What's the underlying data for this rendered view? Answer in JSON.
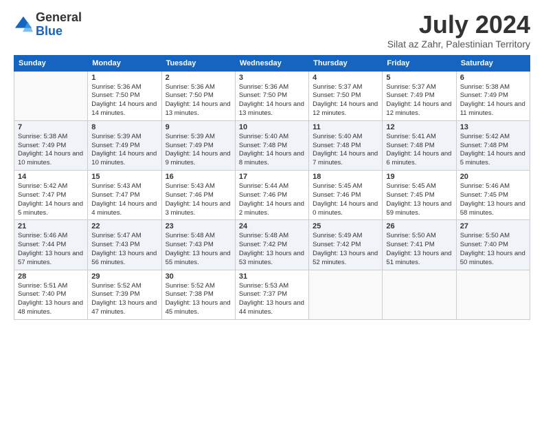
{
  "logo": {
    "general": "General",
    "blue": "Blue"
  },
  "title": "July 2024",
  "subtitle": "Silat az Zahr, Palestinian Territory",
  "days_of_week": [
    "Sunday",
    "Monday",
    "Tuesday",
    "Wednesday",
    "Thursday",
    "Friday",
    "Saturday"
  ],
  "weeks": [
    [
      {
        "day": "",
        "sunrise": "",
        "sunset": "",
        "daylight": ""
      },
      {
        "day": "1",
        "sunrise": "Sunrise: 5:36 AM",
        "sunset": "Sunset: 7:50 PM",
        "daylight": "Daylight: 14 hours and 14 minutes."
      },
      {
        "day": "2",
        "sunrise": "Sunrise: 5:36 AM",
        "sunset": "Sunset: 7:50 PM",
        "daylight": "Daylight: 14 hours and 13 minutes."
      },
      {
        "day": "3",
        "sunrise": "Sunrise: 5:36 AM",
        "sunset": "Sunset: 7:50 PM",
        "daylight": "Daylight: 14 hours and 13 minutes."
      },
      {
        "day": "4",
        "sunrise": "Sunrise: 5:37 AM",
        "sunset": "Sunset: 7:50 PM",
        "daylight": "Daylight: 14 hours and 12 minutes."
      },
      {
        "day": "5",
        "sunrise": "Sunrise: 5:37 AM",
        "sunset": "Sunset: 7:49 PM",
        "daylight": "Daylight: 14 hours and 12 minutes."
      },
      {
        "day": "6",
        "sunrise": "Sunrise: 5:38 AM",
        "sunset": "Sunset: 7:49 PM",
        "daylight": "Daylight: 14 hours and 11 minutes."
      }
    ],
    [
      {
        "day": "7",
        "sunrise": "Sunrise: 5:38 AM",
        "sunset": "Sunset: 7:49 PM",
        "daylight": "Daylight: 14 hours and 10 minutes."
      },
      {
        "day": "8",
        "sunrise": "Sunrise: 5:39 AM",
        "sunset": "Sunset: 7:49 PM",
        "daylight": "Daylight: 14 hours and 10 minutes."
      },
      {
        "day": "9",
        "sunrise": "Sunrise: 5:39 AM",
        "sunset": "Sunset: 7:49 PM",
        "daylight": "Daylight: 14 hours and 9 minutes."
      },
      {
        "day": "10",
        "sunrise": "Sunrise: 5:40 AM",
        "sunset": "Sunset: 7:48 PM",
        "daylight": "Daylight: 14 hours and 8 minutes."
      },
      {
        "day": "11",
        "sunrise": "Sunrise: 5:40 AM",
        "sunset": "Sunset: 7:48 PM",
        "daylight": "Daylight: 14 hours and 7 minutes."
      },
      {
        "day": "12",
        "sunrise": "Sunrise: 5:41 AM",
        "sunset": "Sunset: 7:48 PM",
        "daylight": "Daylight: 14 hours and 6 minutes."
      },
      {
        "day": "13",
        "sunrise": "Sunrise: 5:42 AM",
        "sunset": "Sunset: 7:48 PM",
        "daylight": "Daylight: 14 hours and 5 minutes."
      }
    ],
    [
      {
        "day": "14",
        "sunrise": "Sunrise: 5:42 AM",
        "sunset": "Sunset: 7:47 PM",
        "daylight": "Daylight: 14 hours and 5 minutes."
      },
      {
        "day": "15",
        "sunrise": "Sunrise: 5:43 AM",
        "sunset": "Sunset: 7:47 PM",
        "daylight": "Daylight: 14 hours and 4 minutes."
      },
      {
        "day": "16",
        "sunrise": "Sunrise: 5:43 AM",
        "sunset": "Sunset: 7:46 PM",
        "daylight": "Daylight: 14 hours and 3 minutes."
      },
      {
        "day": "17",
        "sunrise": "Sunrise: 5:44 AM",
        "sunset": "Sunset: 7:46 PM",
        "daylight": "Daylight: 14 hours and 2 minutes."
      },
      {
        "day": "18",
        "sunrise": "Sunrise: 5:45 AM",
        "sunset": "Sunset: 7:46 PM",
        "daylight": "Daylight: 14 hours and 0 minutes."
      },
      {
        "day": "19",
        "sunrise": "Sunrise: 5:45 AM",
        "sunset": "Sunset: 7:45 PM",
        "daylight": "Daylight: 13 hours and 59 minutes."
      },
      {
        "day": "20",
        "sunrise": "Sunrise: 5:46 AM",
        "sunset": "Sunset: 7:45 PM",
        "daylight": "Daylight: 13 hours and 58 minutes."
      }
    ],
    [
      {
        "day": "21",
        "sunrise": "Sunrise: 5:46 AM",
        "sunset": "Sunset: 7:44 PM",
        "daylight": "Daylight: 13 hours and 57 minutes."
      },
      {
        "day": "22",
        "sunrise": "Sunrise: 5:47 AM",
        "sunset": "Sunset: 7:43 PM",
        "daylight": "Daylight: 13 hours and 56 minutes."
      },
      {
        "day": "23",
        "sunrise": "Sunrise: 5:48 AM",
        "sunset": "Sunset: 7:43 PM",
        "daylight": "Daylight: 13 hours and 55 minutes."
      },
      {
        "day": "24",
        "sunrise": "Sunrise: 5:48 AM",
        "sunset": "Sunset: 7:42 PM",
        "daylight": "Daylight: 13 hours and 53 minutes."
      },
      {
        "day": "25",
        "sunrise": "Sunrise: 5:49 AM",
        "sunset": "Sunset: 7:42 PM",
        "daylight": "Daylight: 13 hours and 52 minutes."
      },
      {
        "day": "26",
        "sunrise": "Sunrise: 5:50 AM",
        "sunset": "Sunset: 7:41 PM",
        "daylight": "Daylight: 13 hours and 51 minutes."
      },
      {
        "day": "27",
        "sunrise": "Sunrise: 5:50 AM",
        "sunset": "Sunset: 7:40 PM",
        "daylight": "Daylight: 13 hours and 50 minutes."
      }
    ],
    [
      {
        "day": "28",
        "sunrise": "Sunrise: 5:51 AM",
        "sunset": "Sunset: 7:40 PM",
        "daylight": "Daylight: 13 hours and 48 minutes."
      },
      {
        "day": "29",
        "sunrise": "Sunrise: 5:52 AM",
        "sunset": "Sunset: 7:39 PM",
        "daylight": "Daylight: 13 hours and 47 minutes."
      },
      {
        "day": "30",
        "sunrise": "Sunrise: 5:52 AM",
        "sunset": "Sunset: 7:38 PM",
        "daylight": "Daylight: 13 hours and 45 minutes."
      },
      {
        "day": "31",
        "sunrise": "Sunrise: 5:53 AM",
        "sunset": "Sunset: 7:37 PM",
        "daylight": "Daylight: 13 hours and 44 minutes."
      },
      {
        "day": "",
        "sunrise": "",
        "sunset": "",
        "daylight": ""
      },
      {
        "day": "",
        "sunrise": "",
        "sunset": "",
        "daylight": ""
      },
      {
        "day": "",
        "sunrise": "",
        "sunset": "",
        "daylight": ""
      }
    ]
  ]
}
